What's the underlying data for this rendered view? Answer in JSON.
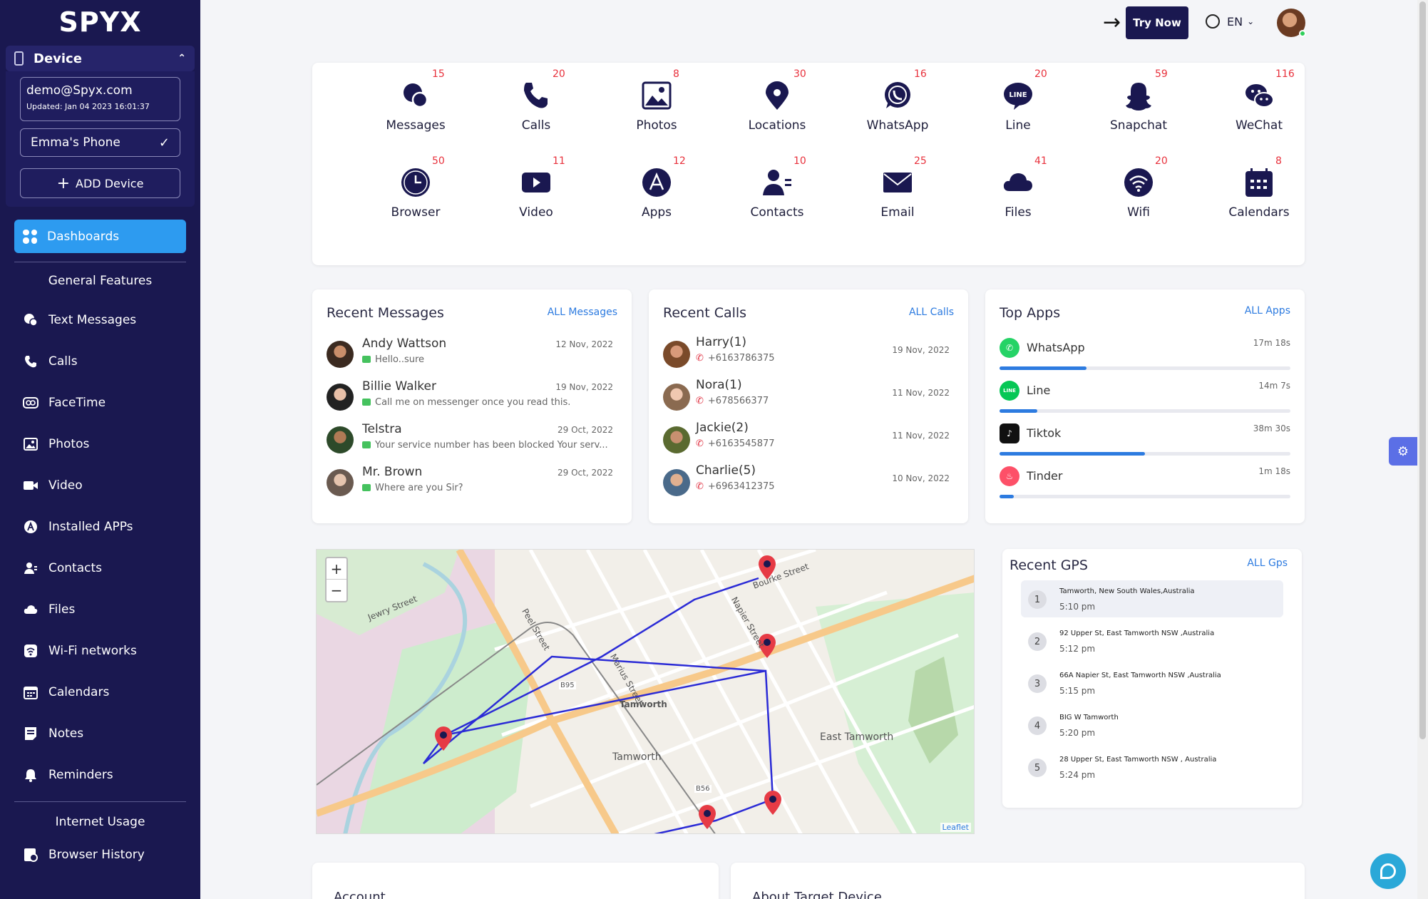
{
  "app": {
    "logo": "SPYX"
  },
  "sidebar": {
    "device_label": "Device",
    "email": "demo@Spyx.com",
    "updated": "Updated: Jan 04 2023 16:01:37",
    "selected_device": "Emma's Phone",
    "add_device": "ADD Device",
    "dashboards": "Dashboards",
    "general_features": "General Features",
    "items": [
      {
        "label": "Text Messages",
        "icon": "messages-icon"
      },
      {
        "label": "Calls",
        "icon": "phone-icon"
      },
      {
        "label": "FaceTime",
        "icon": "facetime-icon"
      },
      {
        "label": "Photos",
        "icon": "image-icon"
      },
      {
        "label": "Video",
        "icon": "video-icon"
      },
      {
        "label": "Installed APPs",
        "icon": "apps-icon"
      },
      {
        "label": "Contacts",
        "icon": "contacts-icon"
      },
      {
        "label": "Files",
        "icon": "cloud-icon"
      },
      {
        "label": "Wi-Fi networks",
        "icon": "wifi-icon"
      },
      {
        "label": "Calendars",
        "icon": "calendar-icon"
      },
      {
        "label": "Notes",
        "icon": "notes-icon"
      },
      {
        "label": "Reminders",
        "icon": "bell-icon"
      }
    ],
    "internet_usage": "Internet Usage",
    "browser_history": "Browser History"
  },
  "topbar": {
    "try_now": "Try Now",
    "lang": "EN"
  },
  "features": [
    {
      "label": "Messages",
      "count": "15"
    },
    {
      "label": "Calls",
      "count": "20"
    },
    {
      "label": "Photos",
      "count": "8"
    },
    {
      "label": "Locations",
      "count": "30"
    },
    {
      "label": "WhatsApp",
      "count": "16"
    },
    {
      "label": "Line",
      "count": "20"
    },
    {
      "label": "Snapchat",
      "count": "59"
    },
    {
      "label": "WeChat",
      "count": "116"
    },
    {
      "label": "Browser",
      "count": "50"
    },
    {
      "label": "Video",
      "count": "11"
    },
    {
      "label": "Apps",
      "count": "12"
    },
    {
      "label": "Contacts",
      "count": "10"
    },
    {
      "label": "Email",
      "count": "25"
    },
    {
      "label": "Files",
      "count": "41"
    },
    {
      "label": "Wifi",
      "count": "20"
    },
    {
      "label": "Calendars",
      "count": "8"
    }
  ],
  "recent_messages": {
    "title": "Recent Messages",
    "link": "ALL Messages",
    "items": [
      {
        "name": "Andy Wattson",
        "date": "12 Nov, 2022",
        "text": "Hello..sure"
      },
      {
        "name": "Billie Walker",
        "date": "19 Nov, 2022",
        "text": "Call me on messenger once you read this."
      },
      {
        "name": "Telstra",
        "date": "29 Oct, 2022",
        "text": "Your service number has been blocked Your serv..."
      },
      {
        "name": "Mr. Brown",
        "date": "29 Oct, 2022",
        "text": "Where are you Sir?"
      }
    ]
  },
  "recent_calls": {
    "title": "Recent Calls",
    "link": "ALL Calls",
    "items": [
      {
        "name": "Harry(1)",
        "number": "+6163786375",
        "date": "19 Nov, 2022"
      },
      {
        "name": "Nora(1)",
        "number": "+678566377",
        "date": "11 Nov, 2022"
      },
      {
        "name": "Jackie(2)",
        "number": "+6163545877",
        "date": "11 Nov, 2022"
      },
      {
        "name": "Charlie(5)",
        "number": "+6963412375",
        "date": "10 Nov, 2022"
      }
    ]
  },
  "top_apps": {
    "title": "Top Apps",
    "link": "ALL Apps",
    "items": [
      {
        "name": "WhatsApp",
        "time": "17m 18s",
        "color": "#25d366",
        "usage": 0.3
      },
      {
        "name": "Line",
        "time": "14m 7s",
        "color": "#06c755",
        "usage": 0.13
      },
      {
        "name": "Tiktok",
        "time": "38m 30s",
        "color": "#111111",
        "usage": 0.5
      },
      {
        "name": "Tinder",
        "time": "1m 18s",
        "color": "#fd5068",
        "usage": 0.05
      }
    ]
  },
  "map": {
    "labels": [
      "Jewry Street",
      "Peel Street",
      "Tamworth",
      "East Tamworth",
      "Marius Street",
      "Napier Street",
      "Bourke Street",
      "B56",
      "B95"
    ],
    "attribution": "Leaflet",
    "zoom_in": "+",
    "zoom_out": "−"
  },
  "recent_gps": {
    "title": "Recent GPS",
    "link": "ALL Gps",
    "items": [
      {
        "num": "1",
        "address": "Tamworth, New South Wales,Australia",
        "time": "5:10 pm"
      },
      {
        "num": "2",
        "address": "92 Upper St,  East Tamworth NSW ,Australia",
        "time": "5:12 pm"
      },
      {
        "num": "3",
        "address": "66A Napier St,  East Tamworth NSW ,Australia",
        "time": "5:15 pm"
      },
      {
        "num": "4",
        "address": "BIG W Tamworth",
        "time": "5:20 pm"
      },
      {
        "num": "5",
        "address": "28 Upper St,  East Tamworth NSW , Australia",
        "time": "5:24 pm"
      }
    ]
  },
  "bottom": {
    "account": "Account",
    "about": "About Target Device"
  }
}
